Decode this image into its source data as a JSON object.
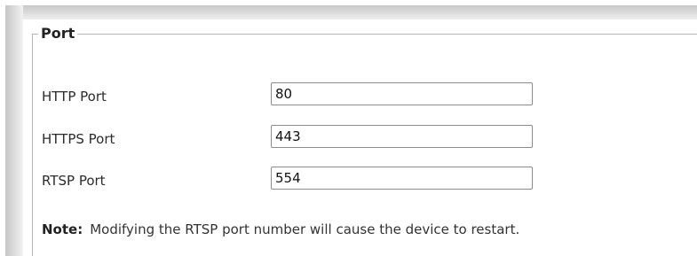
{
  "section": {
    "title": "Port"
  },
  "ports": [
    {
      "label": "HTTP Port",
      "value": "80"
    },
    {
      "label": "HTTPS Port",
      "value": "443"
    },
    {
      "label": "RTSP Port",
      "value": "554"
    }
  ],
  "note": {
    "label": "Note:",
    "text": "Modifying the RTSP port number will cause the device to restart."
  }
}
